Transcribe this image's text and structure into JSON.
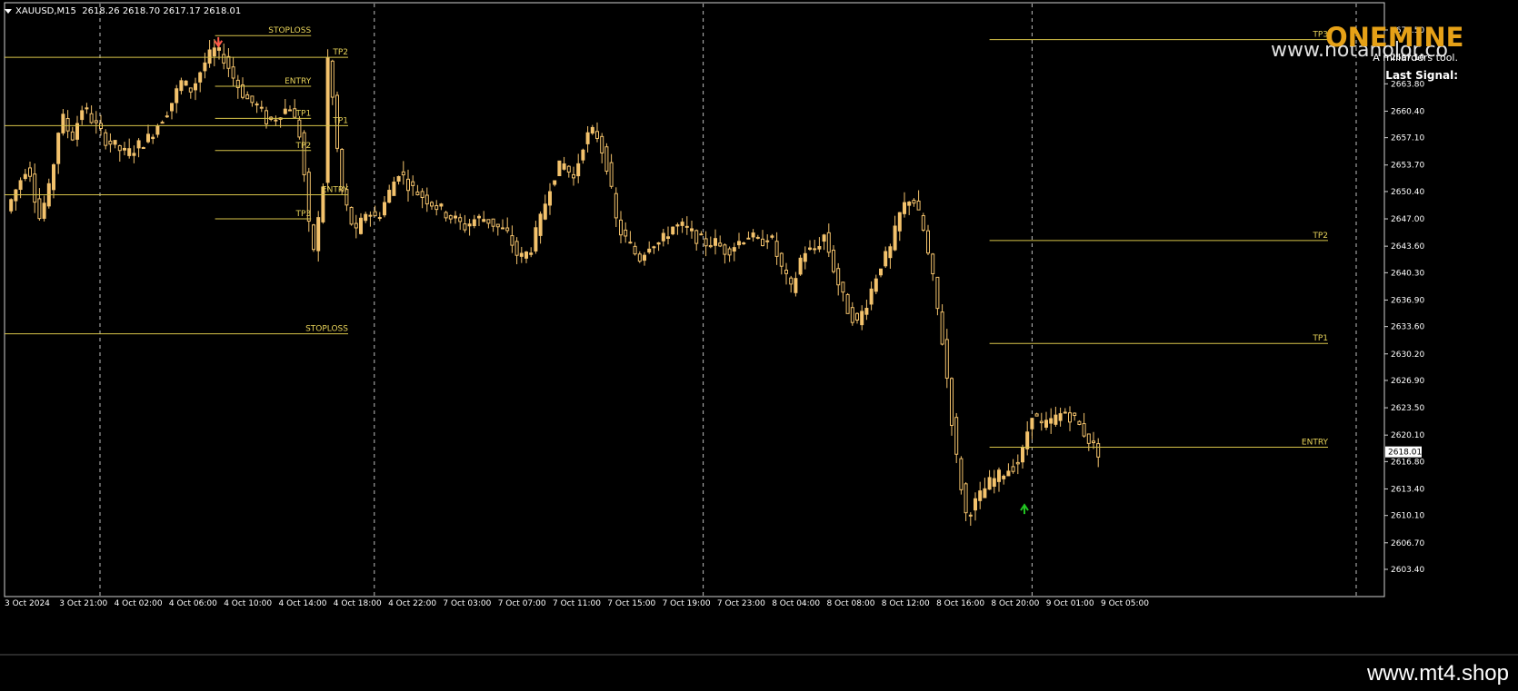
{
  "header": {
    "symbol": "XAUUSD,M15",
    "quote": "2618.26 2618.70 2617.17 2618.01"
  },
  "brand": {
    "name": "ONEMINE",
    "url": "www.notanolor.co",
    "tagline": "A millarders tool.",
    "last_signal_label": "Last Signal:"
  },
  "footer": {
    "url": "www.mt4.shop"
  },
  "colors": {
    "background": "#000000",
    "candle": "#f3c26c",
    "level_line": "#d8c44a",
    "level_text": "#e8d35a",
    "grid": "#bfbfbf",
    "sell_arrow": "#ff5a4a",
    "buy_arrow": "#22c422",
    "brand": "#e6a117"
  },
  "chart_data": {
    "type": "candlestick",
    "x_ticks": [
      "3 Oct 2024",
      "3 Oct 21:00",
      "4 Oct 02:00",
      "4 Oct 06:00",
      "4 Oct 10:00",
      "4 Oct 14:00",
      "4 Oct 18:00",
      "4 Oct 22:00",
      "7 Oct 03:00",
      "7 Oct 07:00",
      "7 Oct 11:00",
      "7 Oct 15:00",
      "7 Oct 19:00",
      "7 Oct 23:00",
      "8 Oct 04:00",
      "8 Oct 08:00",
      "8 Oct 12:00",
      "8 Oct 16:00",
      "8 Oct 20:00",
      "9 Oct 01:00",
      "9 Oct 05:00"
    ],
    "y_ticks": [
      "2670.50",
      "2667.10",
      "2663.80",
      "2660.40",
      "2657.10",
      "2653.70",
      "2650.40",
      "2647.00",
      "2643.60",
      "2640.30",
      "2636.90",
      "2633.60",
      "2630.20",
      "2626.90",
      "2623.50",
      "2620.10",
      "2616.80",
      "2613.40",
      "2610.10",
      "2606.70",
      "2603.40"
    ],
    "ylim": [
      2602.7,
      2672.3
    ],
    "current_price": "2618.01",
    "close_path": [
      [
        0,
        2648
      ],
      [
        2,
        2654
      ],
      [
        3,
        2647
      ],
      [
        4,
        2651
      ],
      [
        5,
        2660
      ],
      [
        6,
        2657
      ],
      [
        7,
        2661
      ],
      [
        8,
        2659
      ],
      [
        9,
        2657
      ],
      [
        10,
        2656
      ],
      [
        11,
        2655
      ],
      [
        12,
        2656
      ],
      [
        13,
        2657
      ],
      [
        14,
        2659
      ],
      [
        15,
        2661
      ],
      [
        16,
        2664
      ],
      [
        17,
        2663
      ],
      [
        18,
        2666
      ],
      [
        19,
        2668
      ],
      [
        20,
        2667
      ],
      [
        21,
        2664
      ],
      [
        22,
        2662
      ],
      [
        23,
        2661
      ],
      [
        24,
        2659
      ],
      [
        25,
        2660
      ],
      [
        26,
        2661
      ],
      [
        27,
        2657
      ],
      [
        28,
        2642
      ],
      [
        29,
        2650
      ],
      [
        29.5,
        2668
      ],
      [
        30.3,
        2656
      ],
      [
        30.8,
        2650
      ],
      [
        32,
        2645
      ],
      [
        33,
        2648
      ],
      [
        34,
        2647
      ],
      [
        35,
        2650
      ],
      [
        36,
        2653
      ],
      [
        37,
        2651
      ],
      [
        38,
        2650
      ],
      [
        39,
        2649
      ],
      [
        40,
        2648
      ],
      [
        41,
        2647
      ],
      [
        42,
        2646
      ],
      [
        43,
        2647
      ],
      [
        44,
        2647
      ],
      [
        45,
        2646
      ],
      [
        46,
        2645
      ],
      [
        47,
        2642
      ],
      [
        48,
        2643
      ],
      [
        49,
        2647
      ],
      [
        50,
        2652
      ],
      [
        51,
        2654
      ],
      [
        52,
        2652
      ],
      [
        53,
        2657
      ],
      [
        54,
        2658
      ],
      [
        55,
        2654
      ],
      [
        56,
        2646
      ],
      [
        57,
        2644
      ],
      [
        58,
        2642
      ],
      [
        59,
        2644
      ],
      [
        60,
        2644
      ],
      [
        61,
        2646
      ],
      [
        62,
        2646
      ],
      [
        63,
        2645
      ],
      [
        64,
        2644
      ],
      [
        65,
        2644
      ],
      [
        66,
        2643
      ],
      [
        67,
        2644
      ],
      [
        68,
        2645
      ],
      [
        69,
        2644
      ],
      [
        70,
        2645
      ],
      [
        71,
        2641
      ],
      [
        72,
        2638
      ],
      [
        73,
        2643
      ],
      [
        74,
        2643
      ],
      [
        75,
        2645
      ],
      [
        76,
        2640
      ],
      [
        77,
        2636
      ],
      [
        78,
        2634
      ],
      [
        79,
        2637
      ],
      [
        80,
        2641
      ],
      [
        81,
        2643
      ],
      [
        82,
        2648
      ],
      [
        83,
        2650
      ],
      [
        84,
        2646
      ],
      [
        85,
        2639
      ],
      [
        86,
        2630
      ],
      [
        87,
        2618
      ],
      [
        88,
        2610
      ],
      [
        89,
        2612
      ],
      [
        90,
        2614
      ],
      [
        91,
        2615
      ],
      [
        92,
        2616
      ],
      [
        93,
        2617
      ],
      [
        94,
        2623
      ],
      [
        95,
        2621
      ],
      [
        96,
        2622
      ],
      [
        97,
        2623
      ],
      [
        98,
        2622
      ],
      [
        99,
        2620
      ],
      [
        100,
        2618
      ]
    ],
    "levels": [
      {
        "label": "STOPLOSS",
        "price": 2669.8,
        "x_from": 19.3,
        "x_to": 28.1,
        "label_side": "right"
      },
      {
        "label": "TP2",
        "price": 2667.1,
        "x_from": 0,
        "x_to": 31.5,
        "label_side": "right"
      },
      {
        "label": "ENTRY",
        "price": 2663.5,
        "x_from": 19.3,
        "x_to": 28.1,
        "label_side": "right"
      },
      {
        "label": "TP1",
        "price": 2659.5,
        "x_from": 19.3,
        "x_to": 28.1,
        "label_side": "right"
      },
      {
        "label": "TP1",
        "price": 2658.6,
        "x_from": 0,
        "x_to": 31.5,
        "label_side": "right"
      },
      {
        "label": "TP2",
        "price": 2655.5,
        "x_from": 19.3,
        "x_to": 28.1,
        "label_side": "right"
      },
      {
        "label": "ENTRY",
        "price": 2650.0,
        "x_from": 0,
        "x_to": 31.5,
        "label_side": "right"
      },
      {
        "label": "TP3",
        "price": 2647.0,
        "x_from": 19.3,
        "x_to": 28.1,
        "label_side": "right"
      },
      {
        "label": "STOPLOSS",
        "price": 2632.7,
        "x_from": 0,
        "x_to": 31.5,
        "label_side": "right"
      },
      {
        "label": "TP3",
        "price": 2669.3,
        "x_from": 90.3,
        "x_to": 122,
        "label_side": "right"
      },
      {
        "label": "TP2",
        "price": 2644.3,
        "x_from": 90.3,
        "x_to": 122,
        "label_side": "right"
      },
      {
        "label": "TP1",
        "price": 2631.5,
        "x_from": 90.3,
        "x_to": 122,
        "label_side": "right"
      },
      {
        "label": "ENTRY",
        "price": 2618.6,
        "x_from": 90.3,
        "x_to": 122,
        "label_side": "right"
      }
    ],
    "signals": [
      {
        "type": "sell",
        "x": 19.6,
        "price": 2668.6
      },
      {
        "type": "buy",
        "x": 93.5,
        "price": 2611.3
      }
    ],
    "grid": "vertical-dashed",
    "legend": "none"
  }
}
